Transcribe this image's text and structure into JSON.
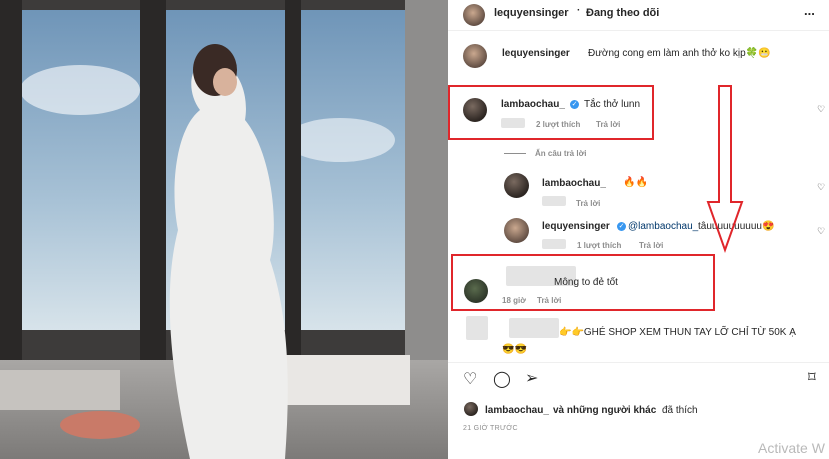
{
  "header": {
    "username": "lequyensinger",
    "follow_status": "Đang theo dõi",
    "more": "..."
  },
  "caption": {
    "username": "lequyensinger",
    "text": "Đường cong em làm anh thở ko kịp🍀😬"
  },
  "comments": [
    {
      "username": "lambaochau_",
      "text": "Tắc thở lunn",
      "likes": "2 lượt thích",
      "reply": "Trả lời",
      "hide_replies": "Ẩn câu trả lời"
    },
    {
      "username": "lambaochau_",
      "text": "🔥🔥",
      "reply": "Trả lời"
    },
    {
      "username": "lequyensinger",
      "mention": "@lambaochau_",
      "text": " tâuuuuuuuuuu😍",
      "likes": "1 lượt thích",
      "reply": "Trả lời"
    },
    {
      "text": "Mông to đẻ tốt",
      "time": "18 giờ",
      "reply": "Trả lời"
    },
    {
      "text": "👉👉GHÉ SHOP XEM THUN TAY LỠ CHỈ TỪ 50K Ạ",
      "extra": "😎😎"
    }
  ],
  "likes_line": {
    "username": "lambaochau_",
    "text": " và những người khác",
    "suffix": " đã thích"
  },
  "timestamp": "21 GIỜ TRƯỚC",
  "watermark": "Activate W",
  "colors": {
    "accent": "#3897f0",
    "highlight": "#e0262b"
  }
}
